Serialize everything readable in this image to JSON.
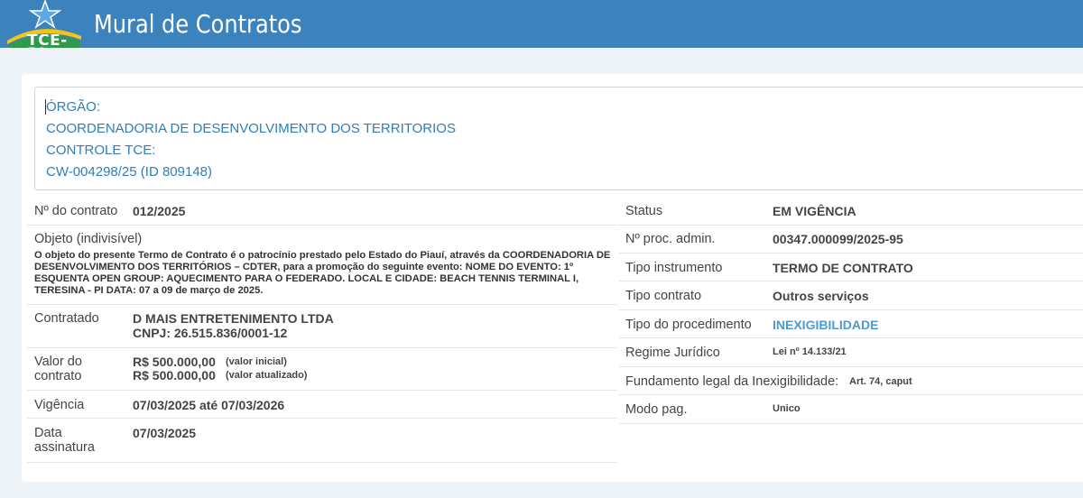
{
  "header": {
    "logo_text": "TCE-PI",
    "title": "Mural de Contratos",
    "colors": {
      "header_bg": "#3c83bd",
      "link": "#2e7fb7"
    }
  },
  "orgao": {
    "orgao_label": "ÓRGÃO:",
    "orgao_value": "COORDENADORIA DE DESENVOLVIMENTO DOS TERRITORIOS",
    "controle_label": "CONTROLE TCE:",
    "controle_value": "CW-004298/25 (ID 809148)"
  },
  "left": {
    "numero_label": "Nº do contrato",
    "numero_value": "012/2025",
    "objeto_label": "Objeto (indivisível)",
    "objeto_text": "O objeto do presente Termo de Contrato é o patrocínio prestado pelo Estado do Piauí, através da COORDENADORIA DE DESENVOLVIMENTO DOS TERRITÓRIOS – CDTER, para a promoção do seguinte evento: NOME DO EVENTO: 1º ESQUENTA OPEN GROUP: AQUECIMENTO PARA O FEDERADO. LOCAL E CIDADE: BEACH TENNIS TERMINAL I, TERESINA - PI DATA: 07 a 09 de março de 2025.",
    "contratado_label": "Contratado",
    "contratado_name": "D MAIS ENTRETENIMENTO LTDA",
    "contratado_cnpj": "CNPJ: 26.515.836/0001-12",
    "valor_label_1": "Valor do",
    "valor_label_2": "contrato",
    "valor_inicial": "R$ 500.000,00",
    "valor_inicial_note": "(valor inicial)",
    "valor_atualizado": "R$ 500.000,00",
    "valor_atualizado_note": "(valor atualizado)",
    "vigencia_label": "Vigência",
    "vigencia_value": "07/03/2025 até 07/03/2026",
    "data_label_1": "Data",
    "data_label_2": "assinatura",
    "data_value": "07/03/2025"
  },
  "right": {
    "status_label": "Status",
    "status_value": "EM VIGÊNCIA",
    "proc_label": "Nº proc. admin.",
    "proc_value": "00347.000099/2025-95",
    "tipo_instr_label": "Tipo instrumento",
    "tipo_instr_value": "TERMO DE CONTRATO",
    "tipo_contrato_label": "Tipo contrato",
    "tipo_contrato_value": "Outros serviços",
    "tipo_proc_label": "Tipo do procedimento",
    "tipo_proc_value": "INEXIGIBILIDADE",
    "regime_label": "Regime Jurídico",
    "regime_value": "Lei nº 14.133/21",
    "fundamento_label": "Fundamento legal da Inexigibilidade:",
    "fundamento_value": "Art. 74, caput",
    "modo_label": "Modo pag.",
    "modo_value": "Unico"
  }
}
